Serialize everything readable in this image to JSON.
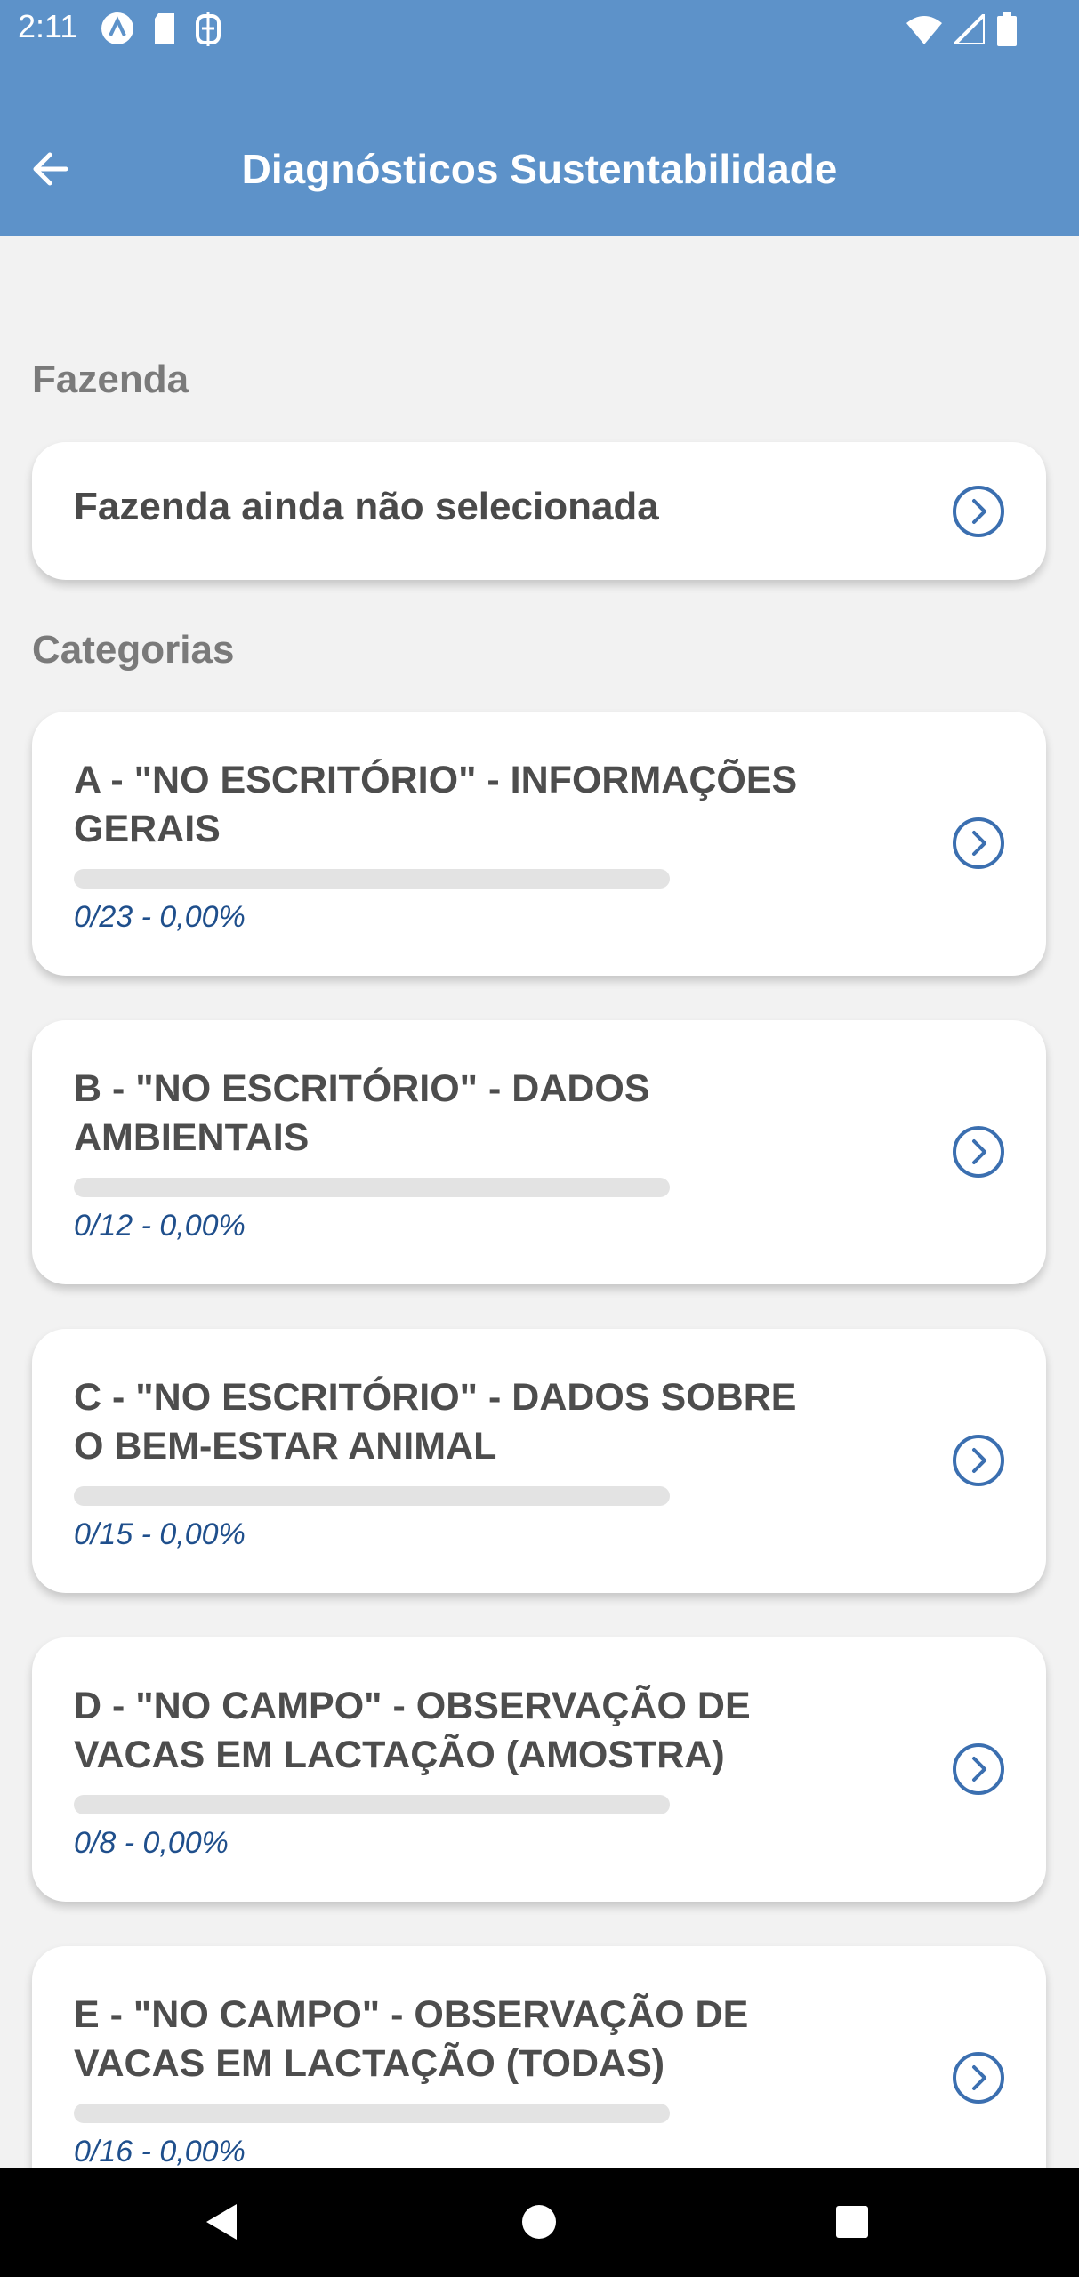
{
  "status_bar": {
    "time": "2:11",
    "left_icons": [
      "app-a-icon",
      "sd-card-icon",
      "cash-icon"
    ],
    "right_icons": [
      "wifi-icon",
      "cell-signal-icon",
      "battery-icon"
    ]
  },
  "app_bar": {
    "title": "Diagnósticos Sustentabilidade",
    "back_icon": "arrow-left-icon"
  },
  "farm_section": {
    "label": "Fazenda",
    "value": "Fazenda ainda não selecionada"
  },
  "categories_section": {
    "label": "Categorias",
    "items": [
      {
        "line1": "A - \"NO ESCRITÓRIO\" - INFORMAÇÕES",
        "line2": "GERAIS",
        "progress_text": "0/23 - 0,00%",
        "progress": 0
      },
      {
        "line1": "B - \"NO ESCRITÓRIO\" - DADOS",
        "line2": "AMBIENTAIS",
        "progress_text": "0/12 - 0,00%",
        "progress": 0
      },
      {
        "line1": "C - \"NO ESCRITÓRIO\" - DADOS SOBRE",
        "line2": "O BEM-ESTAR ANIMAL",
        "progress_text": "0/15 - 0,00%",
        "progress": 0
      },
      {
        "line1": "D - \"NO CAMPO\" - OBSERVAÇÃO DE",
        "line2": "VACAS EM LACTAÇÃO (AMOSTRA)",
        "progress_text": "0/8 - 0,00%",
        "progress": 0
      },
      {
        "line1": "E - \"NO CAMPO\" - OBSERVAÇÃO DE",
        "line2": "VACAS EM LACTAÇÃO (TODAS)",
        "progress_text": "0/16 - 0,00%",
        "progress": 0
      }
    ]
  },
  "colors": {
    "app_bar": "#5d92c9",
    "accent": "#3b6fb0",
    "progress_text": "#1f4f8c"
  }
}
